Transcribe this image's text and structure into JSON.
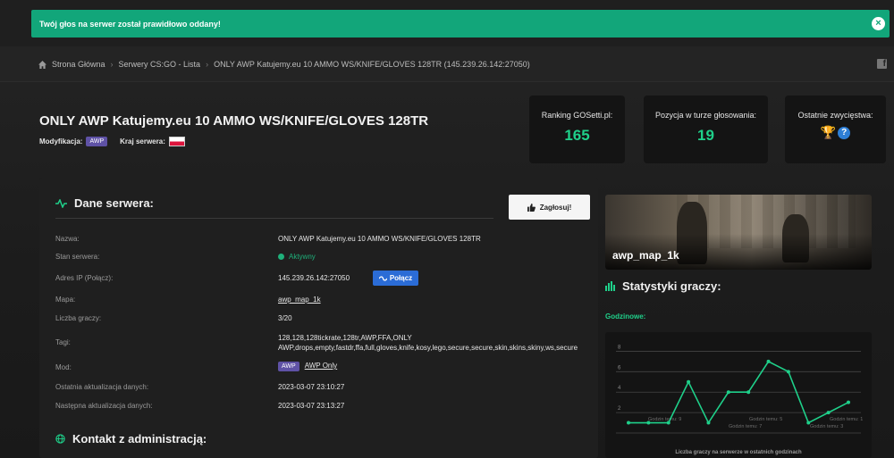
{
  "alert": {
    "message": "Twój głos na serwer został prawidłowo oddany!",
    "close": "×"
  },
  "breadcrumb": {
    "items": [
      "Strona Główna",
      "Serwery CS:GO - Lista",
      "ONLY AWP Katujemy.eu 10 AMMO WS/KNIFE/GLOVES 128TR (145.239.26.142:27050)"
    ],
    "separator": "›"
  },
  "server": {
    "title": "ONLY AWP Katujemy.eu 10 AMMO WS/KNIFE/GLOVES 128TR",
    "mod_label": "Modyfikacja:",
    "mod_badge": "AWP",
    "country_label": "Kraj serwera:"
  },
  "stats": [
    {
      "label": "Ranking GOSetti.pl:",
      "value": "165"
    },
    {
      "label": "Pozycja w turze głosowania:",
      "value": "19"
    },
    {
      "label": "Ostatnie zwycięstwa:",
      "value": ""
    }
  ],
  "details": {
    "title": "Dane serwera:",
    "vote_button": "Zagłosuj!",
    "connect_button": "Połącz",
    "rows": [
      {
        "label": "Nazwa:",
        "value": "ONLY AWP Katujemy.eu 10 AMMO WS/KNIFE/GLOVES 128TR"
      },
      {
        "label": "Stan serwera:",
        "value": "Aktywny"
      },
      {
        "label": "Adres IP (Połącz):",
        "value": "145.239.26.142:27050"
      },
      {
        "label": "Mapa:",
        "value": "awp_map_1k"
      },
      {
        "label": "Liczba graczy:",
        "value": "3/20"
      },
      {
        "label": "Tagi:",
        "value": "128,128,128tickrate,128tr,AWP,FFA,ONLY AWP,drops,empty,fastdr,ffa,full,gloves,knife,kosy,lego,secure,secure,skin,skins,skiny,ws,secure"
      },
      {
        "label": "Mod:",
        "value": "AWP Only",
        "badge": "AWP"
      },
      {
        "label": "Ostatnia aktualizacja danych:",
        "value": "2023-03-07 23:10:27"
      },
      {
        "label": "Następna aktualizacja danych:",
        "value": "2023-03-07 23:13:27"
      }
    ],
    "admin_title": "Kontakt z administracją:"
  },
  "map": {
    "name": "awp_map_1k"
  },
  "player_stats": {
    "title": "Statystyki graczy:",
    "hourly_label": "Godzinowe:"
  },
  "chart_data": {
    "type": "line",
    "title": "",
    "xlabel": "Liczba graczy na serwerze w ostatnich godzinach",
    "ylabel": "",
    "y_ticks": [
      2,
      4,
      6,
      8
    ],
    "ylim": [
      0,
      9
    ],
    "x_annotations": [
      "Godzin temu: 9",
      "Godzin temu: 7",
      "Godzin temu: 5",
      "Godzin temu: 3",
      "Godzin temu: 1"
    ],
    "series": [
      {
        "values": [
          1,
          1,
          1,
          5,
          1,
          4,
          4,
          7,
          6,
          1,
          2,
          3
        ]
      }
    ],
    "color": "#1fd08a",
    "grid": true
  },
  "colors": {
    "accent": "#1fd08a",
    "alert": "#12a67a",
    "badge": "#5f52a6",
    "connect": "#2b6cd6"
  }
}
